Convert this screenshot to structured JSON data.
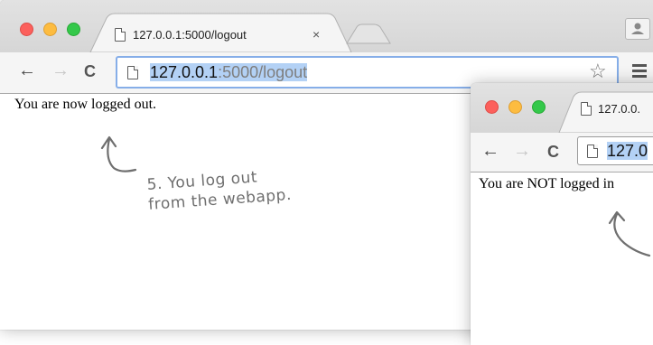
{
  "window_front": {
    "tab": {
      "title": "127.0.0.1:5000/logout",
      "close_glyph": "×"
    },
    "toolbar": {
      "back_glyph": "←",
      "forward_glyph": "→",
      "reload_glyph": "C",
      "url_host": "127.0.0.1",
      "url_rest": ":5000/logout",
      "bookmark_glyph": "☆"
    },
    "page": {
      "text": "You are now logged out."
    },
    "annotation": {
      "line1": "5. You log out",
      "line2": "from the webapp."
    }
  },
  "window_back": {
    "tab": {
      "title": "127.0.0."
    },
    "toolbar": {
      "back_glyph": "←",
      "forward_glyph": "→",
      "reload_glyph": "C",
      "url_partial": "127.0"
    },
    "page": {
      "text": "You are NOT logged in"
    }
  },
  "colors": {
    "traffic_red": "#fc605c",
    "traffic_yellow": "#fdbc40",
    "traffic_green": "#34c84a",
    "url_selection": "#b3d1f5",
    "omnibox_focus": "#86aee8",
    "annotation": "#6f6f6f"
  },
  "icons": [
    "page-icon",
    "close-icon",
    "new-tab-icon",
    "profile-icon",
    "back-icon",
    "forward-icon",
    "reload-icon",
    "star-icon",
    "menu-icon",
    "arrow-annotation-icon"
  ]
}
